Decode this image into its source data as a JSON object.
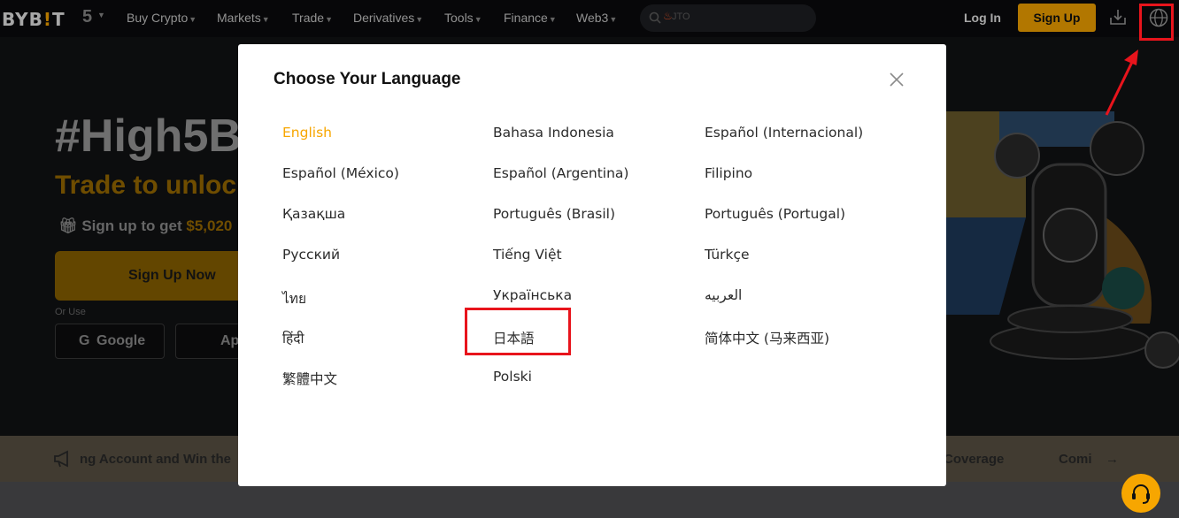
{
  "nav": {
    "logo": "BYB",
    "logo_bang": "!",
    "logo_end": "T",
    "five": "5",
    "items": [
      "Buy Crypto",
      "Markets",
      "Trade",
      "Derivatives",
      "Tools",
      "Finance",
      "Web3"
    ],
    "search_value": "JTO",
    "login": "Log In",
    "signup": "Sign Up"
  },
  "hero": {
    "title": "#High5B",
    "subtitle": "Trade to unloc",
    "bonus_prefix": "Sign up to get ",
    "bonus_amount": "$5,020",
    "cta": "Sign Up Now",
    "or_use": "Or Use",
    "google": "Google",
    "apple": "Ap"
  },
  "band": {
    "left_text": "ng Account and Win the",
    "right_text_1": "Coverage",
    "right_text_2": "Comi"
  },
  "modal": {
    "title": "Choose Your Language",
    "languages": [
      "English",
      "Bahasa Indonesia",
      "Español (Internacional)",
      "Español (México)",
      "Español (Argentina)",
      "Filipino",
      "Қазақша",
      "Português (Brasil)",
      "Português (Portugal)",
      "Русский",
      "Tiếng Việt",
      "Türkçe",
      "ไทย",
      "Українська",
      "العربيه",
      "हिंदी",
      "日本語",
      "简体中文 (马来西亚)",
      "繁體中文",
      "Polski"
    ],
    "active_language": "English"
  },
  "colors": {
    "accent": "#f7a600",
    "highlight_box": "#e8141c"
  }
}
